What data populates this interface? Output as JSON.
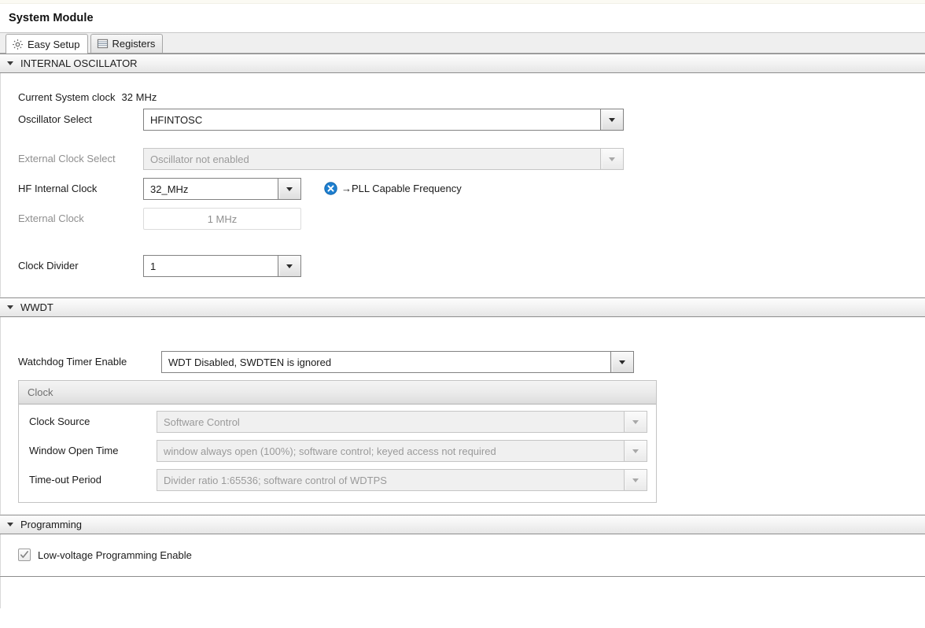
{
  "window": {
    "title": "System Module"
  },
  "tabs": [
    {
      "label": "Easy Setup",
      "icon": "gear-icon",
      "active": true
    },
    {
      "label": "Registers",
      "icon": "registers-list-icon",
      "active": false
    }
  ],
  "sections": {
    "internal_oscillator": {
      "title": "INTERNAL OSCILLATOR",
      "expanded": true,
      "current_system_clock": {
        "label": "Current System clock",
        "value": "32 MHz"
      },
      "oscillator_select": {
        "label": "Oscillator Select",
        "value": "HFINTOSC",
        "enabled": true
      },
      "external_clock_select": {
        "label": "External Clock Select",
        "value": "Oscillator not enabled",
        "enabled": false
      },
      "hf_internal_clock": {
        "label": "HF Internal Clock",
        "value": "32_MHz",
        "enabled": true,
        "note": "→PLL Capable Frequency",
        "note_icon": "pll-blue-x-icon"
      },
      "external_clock": {
        "label": "External Clock",
        "value": "1 MHz",
        "enabled": false
      },
      "clock_divider": {
        "label": "Clock Divider",
        "value": "1",
        "enabled": true
      }
    },
    "wwdt": {
      "title": "WWDT",
      "expanded": true,
      "watchdog_timer_enable": {
        "label": "Watchdog Timer Enable",
        "value": "WDT Disabled, SWDTEN is ignored",
        "enabled": true
      },
      "clock_group": {
        "title": "Clock",
        "clock_source": {
          "label": "Clock Source",
          "value": "Software Control",
          "enabled": false
        },
        "window_open_time": {
          "label": "Window Open Time",
          "value": "window always open (100%); software control; keyed access not required",
          "enabled": false
        },
        "timeout_period": {
          "label": "Time-out Period",
          "value": "Divider ratio 1:65536; software control of WDTPS",
          "enabled": false
        }
      }
    },
    "programming": {
      "title": "Programming",
      "expanded": true,
      "low_voltage_programming_enable": {
        "label": "Low-voltage Programming Enable",
        "checked": true,
        "enabled": false
      }
    }
  },
  "colors": {
    "accent_blue": "#1d7fd0",
    "section_border": "#8d8d8d",
    "field_border": "#828282",
    "disabled_text": "#9a9a9a"
  }
}
